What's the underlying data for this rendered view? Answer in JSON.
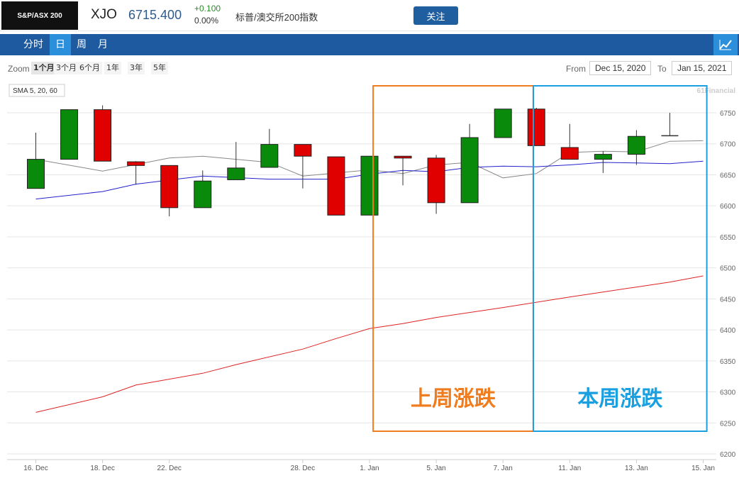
{
  "header": {
    "logo": "S&P/ASX 200",
    "symbol": "XJO",
    "price": "6715.400",
    "change": "+0.100",
    "change_pct": "0.00%",
    "name": "标普/澳交所200指数",
    "follow_label": "关注"
  },
  "nav": {
    "tabs": [
      "分时",
      "日",
      "周",
      "月"
    ],
    "active": "日",
    "chart_icon": "line-chart-icon"
  },
  "zoom": {
    "label": "Zoom",
    "options": [
      "1个月",
      "3个月",
      "6个月",
      "1年",
      "3年",
      "5年"
    ],
    "active": "1个月",
    "from_label": "From",
    "from_value": "Dec 15, 2020",
    "to_label": "To",
    "to_value": "Jan 15, 2021"
  },
  "chart_data": {
    "type": "candlestick",
    "legend": "SMA 5, 20, 60",
    "watermark": "61Financial",
    "ylim": [
      6200,
      6770
    ],
    "yticks": [
      6200,
      6250,
      6300,
      6350,
      6400,
      6450,
      6500,
      6550,
      6600,
      6650,
      6700,
      6750
    ],
    "xtick_labels": [
      {
        "i": 0,
        "label": "16. Dec"
      },
      {
        "i": 2,
        "label": "18. Dec"
      },
      {
        "i": 4,
        "label": "22. Dec"
      },
      {
        "i": 8,
        "label": "28. Dec"
      },
      {
        "i": 10,
        "label": "1. Jan"
      },
      {
        "i": 12,
        "label": "5. Jan"
      },
      {
        "i": 14,
        "label": "7. Jan"
      },
      {
        "i": 16,
        "label": "11. Jan"
      },
      {
        "i": 18,
        "label": "13. Jan"
      },
      {
        "i": 20,
        "label": "15. Jan"
      }
    ],
    "candles": [
      {
        "date": "16. Dec",
        "open": 6628,
        "close": 6675,
        "high": 6718,
        "low": 6628
      },
      {
        "date": "17. Dec",
        "open": 6675,
        "close": 6755,
        "high": 6755,
        "low": 6675
      },
      {
        "date": "18. Dec",
        "open": 6755,
        "close": 6672,
        "high": 6762,
        "low": 6672
      },
      {
        "date": "21. Dec",
        "open": 6671,
        "close": 6665,
        "high": 6672,
        "low": 6634
      },
      {
        "date": "22. Dec",
        "open": 6665,
        "close": 6597,
        "high": 6665,
        "low": 6583
      },
      {
        "date": "23. Dec",
        "open": 6597,
        "close": 6640,
        "high": 6657,
        "low": 6597
      },
      {
        "date": "24. Dec",
        "open": 6642,
        "close": 6661,
        "high": 6703,
        "low": 6642
      },
      {
        "date": "29. Dec",
        "open": 6662,
        "close": 6699,
        "high": 6724,
        "low": 6662
      },
      {
        "date": "30. Dec",
        "open": 6699,
        "close": 6680,
        "high": 6699,
        "low": 6628
      },
      {
        "date": "31. Dec",
        "open": 6679,
        "close": 6585,
        "high": 6679,
        "low": 6585
      },
      {
        "date": "4. Jan",
        "open": 6585,
        "close": 6680,
        "high": 6680,
        "low": 6585
      },
      {
        "date": "5. Jan",
        "open": 6680,
        "close": 6677,
        "high": 6680,
        "low": 6633
      },
      {
        "date": "6. Jan",
        "open": 6677,
        "close": 6605,
        "high": 6682,
        "low": 6587
      },
      {
        "date": "7. Jan",
        "open": 6605,
        "close": 6710,
        "high": 6732,
        "low": 6605
      },
      {
        "date": "8. Jan",
        "open": 6710,
        "close": 6756,
        "high": 6756,
        "low": 6710
      },
      {
        "date": "11. Jan",
        "open": 6756,
        "close": 6697,
        "high": 6758,
        "low": 6697
      },
      {
        "date": "12. Jan",
        "open": 6694,
        "close": 6675,
        "high": 6732,
        "low": 6675
      },
      {
        "date": "13. Jan",
        "open": 6675,
        "close": 6683,
        "high": 6688,
        "low": 6653
      },
      {
        "date": "14. Jan",
        "open": 6683,
        "close": 6712,
        "high": 6722,
        "low": 6666
      },
      {
        "date": "15. Jan",
        "open": 6713,
        "close": 6713,
        "high": 6750,
        "low": 6713
      }
    ],
    "sma": [
      {
        "name": "SMA 5",
        "color": "#888888",
        "points": [
          [
            0,
            6675
          ],
          [
            2,
            6656
          ],
          [
            4,
            6677
          ],
          [
            5,
            6680
          ],
          [
            7,
            6670
          ],
          [
            8,
            6648
          ],
          [
            10,
            6658
          ],
          [
            11,
            6652
          ],
          [
            12,
            6666
          ],
          [
            13,
            6670
          ],
          [
            14,
            6645
          ],
          [
            15,
            6652
          ],
          [
            16,
            6686
          ],
          [
            17,
            6688
          ],
          [
            18,
            6687
          ],
          [
            19,
            6704
          ],
          [
            20,
            6705
          ]
        ]
      },
      {
        "name": "SMA 20",
        "color": "#2222cc",
        "points": [
          [
            0,
            6611
          ],
          [
            2,
            6623
          ],
          [
            3,
            6635
          ],
          [
            5,
            6648
          ],
          [
            7,
            6643
          ],
          [
            9,
            6643
          ],
          [
            10,
            6651
          ],
          [
            11,
            6657
          ],
          [
            12,
            6655
          ],
          [
            13,
            6662
          ],
          [
            14,
            6664
          ],
          [
            15,
            6663
          ],
          [
            16,
            6666
          ],
          [
            17,
            6670
          ],
          [
            18,
            6669
          ],
          [
            19,
            6668
          ],
          [
            20,
            6672
          ]
        ]
      },
      {
        "name": "SMA 60",
        "color": "#dd2222",
        "points": [
          [
            0,
            6267
          ],
          [
            2,
            6292
          ],
          [
            3,
            6311
          ],
          [
            5,
            6330
          ],
          [
            6,
            6344
          ],
          [
            8,
            6369
          ],
          [
            9,
            6386
          ],
          [
            10,
            6402
          ],
          [
            11,
            6410
          ],
          [
            12,
            6420
          ],
          [
            14,
            6436
          ],
          [
            16,
            6453
          ],
          [
            17,
            6461
          ],
          [
            18,
            6469
          ],
          [
            19,
            6477
          ],
          [
            20,
            6487
          ]
        ]
      }
    ],
    "annotations": [
      {
        "label": "上周涨跌",
        "color": "#f07c20",
        "from_i": 10.3,
        "to_i": 15.1
      },
      {
        "label": "本周涨跌",
        "color": "#1aa0e0",
        "from_i": 15.1,
        "to_i": 20.3
      }
    ]
  }
}
